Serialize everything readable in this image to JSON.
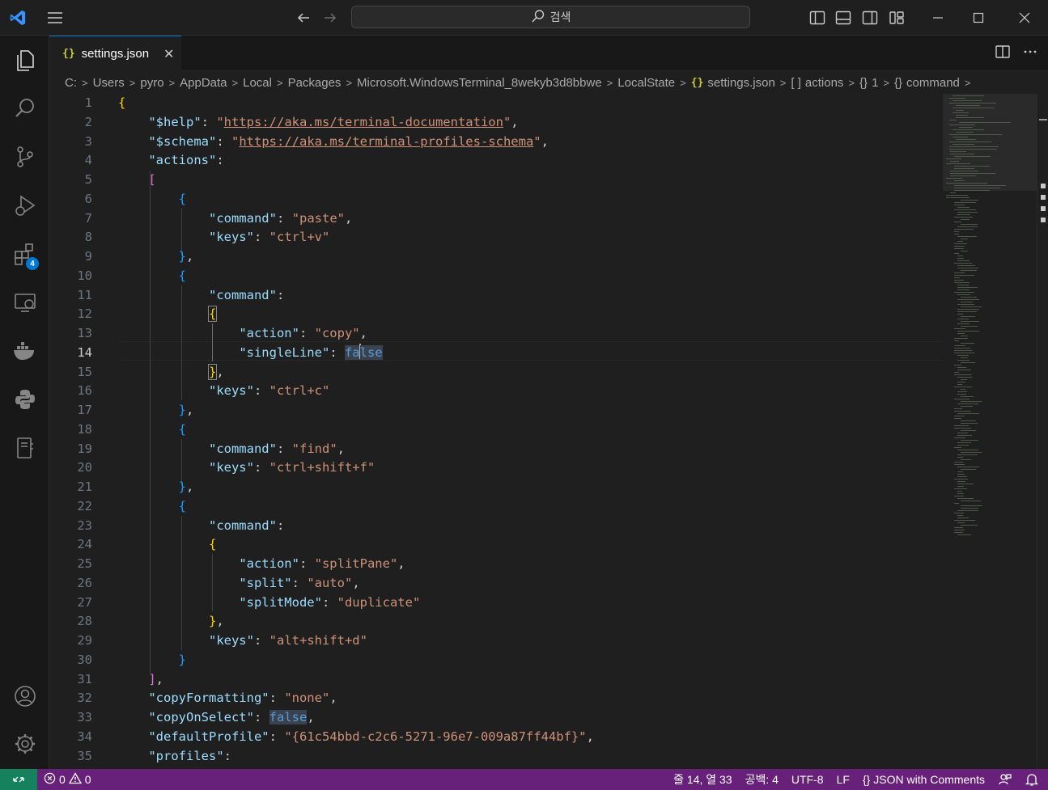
{
  "titlebar": {
    "search_placeholder": "검색",
    "logo_icon": "vscode-logo-icon",
    "window_controls": [
      "minimize-icon",
      "maximize-icon",
      "close-icon"
    ]
  },
  "tab": {
    "label": "settings.json",
    "icon": "{}"
  },
  "breadcrumb": {
    "items": [
      "C:",
      "Users",
      "pyro",
      "AppData",
      "Local",
      "Packages",
      "Microsoft.WindowsTerminal_8wekyb3d8bbwe",
      "LocalState",
      "settings.json",
      "actions",
      "1",
      "command"
    ],
    "json_icon": "{}",
    "array_icon": "[ ]",
    "object_icon": "{}"
  },
  "activity_bar": {
    "extensions_badge": "4"
  },
  "editor": {
    "current_line": 14,
    "line_numbers": [
      "1",
      "2",
      "3",
      "4",
      "5",
      "6",
      "7",
      "8",
      "9",
      "10",
      "11",
      "12",
      "13",
      "14",
      "15",
      "16",
      "17",
      "18",
      "19",
      "20",
      "21",
      "22",
      "23",
      "24",
      "25",
      "26",
      "27",
      "28",
      "29",
      "30",
      "31",
      "32",
      "33",
      "34",
      "35"
    ],
    "tokens": {
      "help_key": "\"$help\"",
      "help_q1": "\"",
      "help_url": "https://aka.ms/terminal-documentation",
      "help_q2": "\"",
      "schema_key": "\"$schema\"",
      "schema_q1": "\"",
      "schema_url": "https://aka.ms/terminal-profiles-schema",
      "schema_q2": "\"",
      "actions_key": "\"actions\"",
      "command_key": "\"command\"",
      "keys_key": "\"keys\"",
      "action_key": "\"action\"",
      "singleline_key": "\"singleLine\"",
      "split_key": "\"split\"",
      "splitmode_key": "\"splitMode\"",
      "paste_val": "\"paste\"",
      "ctrlv_val": "\"ctrl+v\"",
      "copy_val": "\"copy\"",
      "false_a": "fa",
      "false_b": "lse",
      "ctrlc_val": "\"ctrl+c\"",
      "find_val": "\"find\"",
      "ctrlshiftf_val": "\"ctrl+shift+f\"",
      "splitpane_val": "\"splitPane\"",
      "auto_val": "\"auto\"",
      "duplicate_val": "\"duplicate\"",
      "altshiftd_val": "\"alt+shift+d\"",
      "copyformatting_key": "\"copyFormatting\"",
      "none_val": "\"none\"",
      "copyonselect_key": "\"copyOnSelect\"",
      "false_val": "false",
      "defaultprofile_key": "\"defaultProfile\"",
      "defaultprofile_val": "\"{61c54bbd-c2c6-5271-96e7-009a87ff44bf}\"",
      "profiles_key": "\"profiles\""
    }
  },
  "statusbar": {
    "errors": "0",
    "warnings": "0",
    "cursor_position": "줄 14, 열 33",
    "indentation": "공백: 4",
    "encoding": "UTF-8",
    "eol": "LF",
    "language_icon": "{}",
    "language": "JSON with Comments"
  }
}
